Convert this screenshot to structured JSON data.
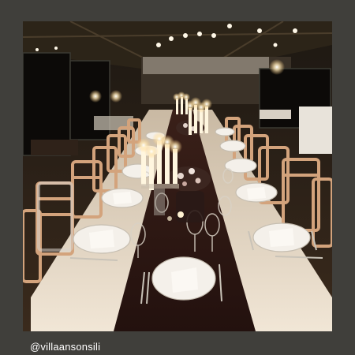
{
  "caption": {
    "handle": "@villaansonsili"
  },
  "colors": {
    "frame_bg": "#403f3b",
    "tablecloth": "#efe3d2",
    "runner": "#2a1612",
    "chair": "#d1a07a",
    "candle": "#fff6df"
  }
}
